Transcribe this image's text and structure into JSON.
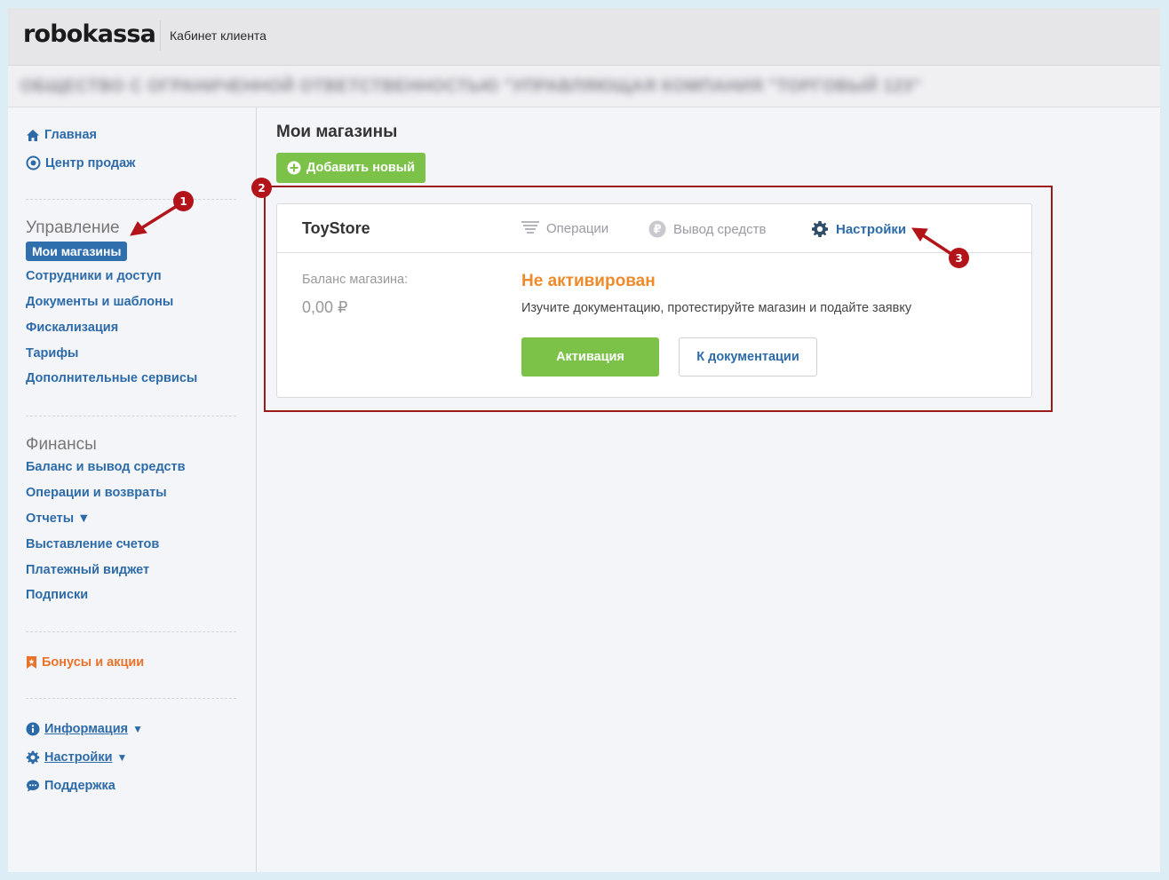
{
  "header": {
    "logo": "robokassa",
    "subtitle": "Кабинет клиента"
  },
  "org": {
    "name": "ОБЩЕСТВО С ОГРАНИЧЕННОЙ ОТВЕТСТВЕННОСТЬЮ \"УПРАВЛЯЮЩАЯ КОМПАНИЯ \"ТОРГОВЫЙ 123\""
  },
  "sidebar": {
    "top": {
      "home": "Главная",
      "sales_center": "Центр продаж"
    },
    "management": {
      "title": "Управление",
      "items": [
        "Мои магазины",
        "Сотрудники и доступ",
        "Документы и шаблоны",
        "Фискализация",
        "Тарифы",
        "Дополнительные сервисы"
      ]
    },
    "finance": {
      "title": "Финансы",
      "items": [
        "Баланс и вывод средств",
        "Операции и возвраты",
        "Отчеты ▼",
        "Выставление счетов",
        "Платежный виджет",
        "Подписки"
      ]
    },
    "bonus": "Бонусы и акции",
    "bottom": {
      "info": "Информация",
      "settings": "Настройки",
      "support": "Поддержка",
      "caret": "▼"
    }
  },
  "main": {
    "title": "Мои магазины",
    "add_button": "Добавить новый",
    "store": {
      "name": "ToyStore",
      "tabs": {
        "operations": "Операции",
        "withdraw": "Вывод средств",
        "settings": "Настройки"
      },
      "balance_label": "Баланс магазина:",
      "balance_value": "0,00 ₽",
      "status_title": "Не активирован",
      "status_desc": "Изучите документацию, протестируйте магазин и подайте заявку",
      "activate_button": "Активация",
      "docs_button": "К документации"
    }
  },
  "annotations": {
    "badge1": "1",
    "badge2": "2",
    "badge3": "3"
  },
  "colors": {
    "brand_blue": "#2d6ba8",
    "green": "#7cc249",
    "orange": "#ef8a2a",
    "annotation_red": "#b3141a"
  }
}
